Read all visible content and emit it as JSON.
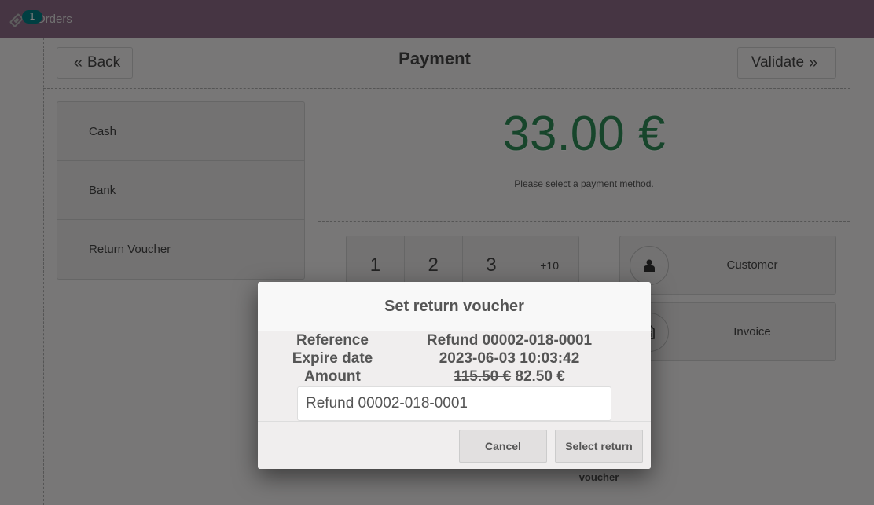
{
  "navbar": {
    "orders_label": "Orders",
    "orders_count": "1",
    "ticket_icon": "ticket-icon"
  },
  "header": {
    "back_label": "Back",
    "back_icon": "«",
    "title": "Payment",
    "validate_label": "Validate",
    "validate_icon": "»"
  },
  "payment_methods": [
    {
      "label": "Cash"
    },
    {
      "label": "Bank"
    },
    {
      "label": "Return Voucher"
    }
  ],
  "summary": {
    "due_amount": "33.00 €",
    "hint": "Please select a payment method."
  },
  "numpad": {
    "keys": [
      "1",
      "2",
      "3",
      "+10"
    ]
  },
  "side_buttons": {
    "customer": {
      "label": "Customer",
      "icon": "user-icon"
    },
    "invoice": {
      "label": "Invoice",
      "icon": "invoice-icon"
    }
  },
  "background_text": {
    "voucher": "voucher"
  },
  "modal": {
    "title": "Set return voucher",
    "rows": [
      {
        "key": "Reference",
        "value": "Refund 00002-018-0001"
      },
      {
        "key": "Expire date",
        "value": "2023-06-03 10:03:42"
      },
      {
        "key": "Amount",
        "original_value": "115.50 €",
        "value": "82.50 €"
      }
    ],
    "input_value": "Refund 00002-018-0001",
    "cancel_label": "Cancel",
    "select_label": "Select return"
  },
  "colors": {
    "navbar": "#8d6a86",
    "amount_green": "#2e8a57",
    "badge": "#017e84"
  }
}
